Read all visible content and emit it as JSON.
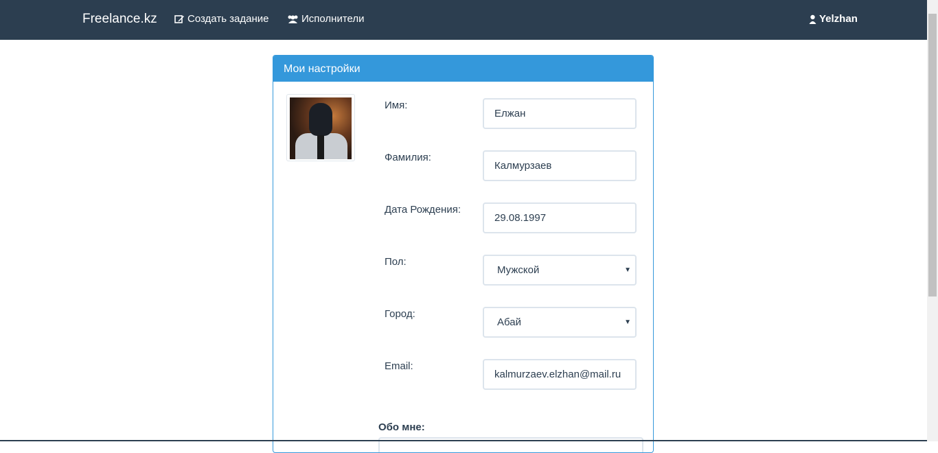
{
  "navbar": {
    "brand": "Freelance.kz",
    "create_task": "Создать задание",
    "executors": "Исполнители",
    "user": "Yelzhan"
  },
  "panel": {
    "title": "Мои настройки"
  },
  "form": {
    "first_name_label": "Имя:",
    "first_name_value": "Елжан",
    "last_name_label": "Фамилия:",
    "last_name_value": "Калмурзаев",
    "birth_label": "Дата Рождения:",
    "birth_value": "29.08.1997",
    "gender_label": "Пол:",
    "gender_value": "Мужской",
    "city_label": "Город:",
    "city_value": "Абай",
    "email_label": "Email:",
    "email_value": "kalmurzaev.elzhan@mail.ru",
    "about_label": "Обо мне:"
  },
  "icons": {
    "create": "edit-icon",
    "executors": "users-icon",
    "user": "user-icon",
    "select": "caret-down-icon"
  },
  "colors": {
    "navbar": "#2c3e50",
    "accent": "#3498db"
  }
}
